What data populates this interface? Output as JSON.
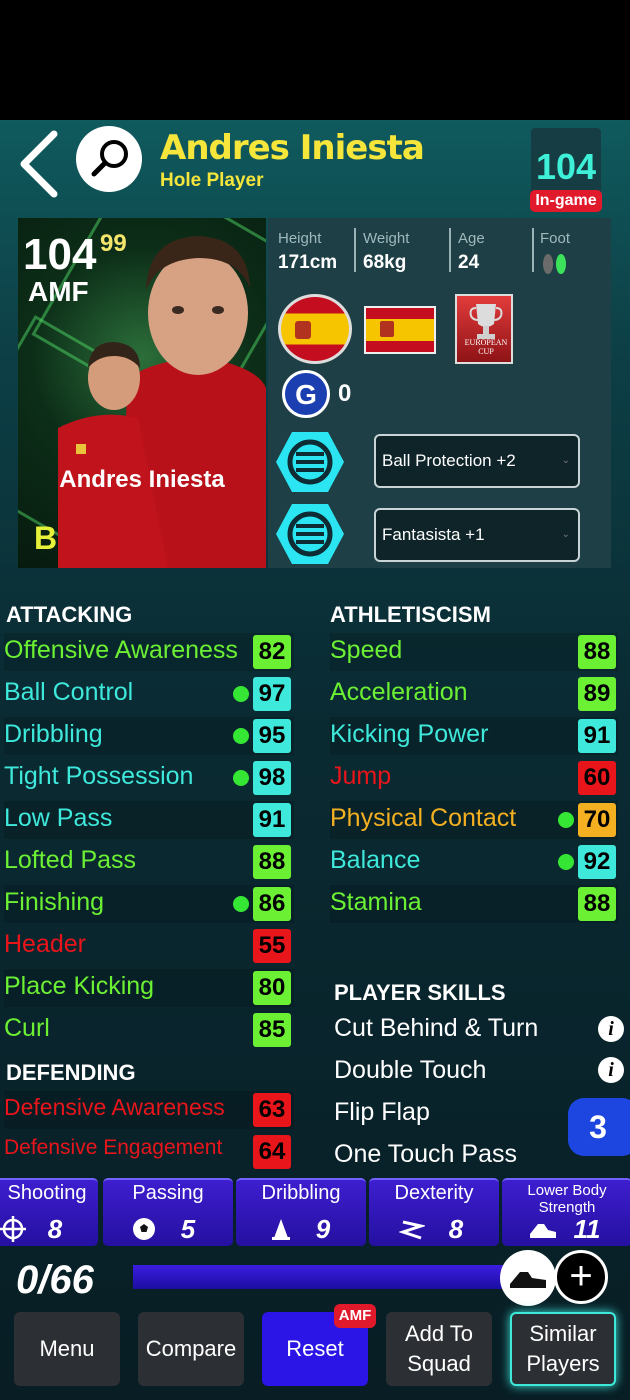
{
  "header": {
    "player_name": "Andres Iniesta",
    "role": "Hole Player",
    "overall": "104",
    "overall_label": "In-game"
  },
  "card": {
    "rating": "104",
    "rating_max": "99",
    "position": "AMF",
    "name": "Andres Iniesta",
    "grade": "B"
  },
  "physical": {
    "height_label": "Height",
    "height": "171cm",
    "weight_label": "Weight",
    "weight": "68kg",
    "age_label": "Age",
    "age": "24",
    "foot_label": "Foot"
  },
  "badges": {
    "cup_label": "EUROPEAN CUP",
    "g_count": "0"
  },
  "boosts": [
    "Ball Protection +2",
    "Fantasista +1"
  ],
  "attacking": {
    "title": "ATTACKING",
    "stats": [
      {
        "label": "Offensive Awareness",
        "value": "82"
      },
      {
        "label": "Ball Control",
        "value": "97"
      },
      {
        "label": "Dribbling",
        "value": "95"
      },
      {
        "label": "Tight Possession",
        "value": "98"
      },
      {
        "label": "Low Pass",
        "value": "91"
      },
      {
        "label": "Lofted Pass",
        "value": "88"
      },
      {
        "label": "Finishing",
        "value": "86"
      },
      {
        "label": "Header",
        "value": "55"
      },
      {
        "label": "Place Kicking",
        "value": "80"
      },
      {
        "label": "Curl",
        "value": "85"
      }
    ]
  },
  "defending": {
    "title": "DEFENDING",
    "stats": [
      {
        "label": "Defensive Awareness",
        "value": "63"
      },
      {
        "label": "Defensive Engagement",
        "value": "64"
      }
    ]
  },
  "athleticism": {
    "title": "ATHLETISCISM",
    "stats": [
      {
        "label": "Speed",
        "value": "88"
      },
      {
        "label": "Acceleration",
        "value": "89"
      },
      {
        "label": "Kicking Power",
        "value": "91"
      },
      {
        "label": "Jump",
        "value": "60"
      },
      {
        "label": "Physical Contact",
        "value": "70"
      },
      {
        "label": "Balance",
        "value": "92"
      },
      {
        "label": "Stamina",
        "value": "88"
      }
    ]
  },
  "player_skills": {
    "title": "PLAYER SKILLS",
    "items": [
      "Cut Behind & Turn",
      "Double Touch",
      "Flip Flap",
      "One Touch Pass"
    ],
    "more_count": "3"
  },
  "progression": {
    "categories": [
      {
        "label": "Shooting",
        "value": "8"
      },
      {
        "label": "Passing",
        "value": "5"
      },
      {
        "label": "Dribbling",
        "value": "9"
      },
      {
        "label": "Dexterity",
        "value": "8"
      },
      {
        "label": "Lower Body Strength",
        "value": "11"
      }
    ],
    "points": "0/66"
  },
  "buttons": {
    "menu": "Menu",
    "compare": "Compare",
    "reset": "Reset",
    "reset_tag": "AMF",
    "add_to_squad": "Add To Squad",
    "similar_players": "Similar Players"
  },
  "colors": {
    "green": "#6cf034",
    "cyan": "#3ee8db",
    "red": "#e8151b",
    "orange": "#f5b021",
    "accent_yellow": "#f6e53a"
  }
}
